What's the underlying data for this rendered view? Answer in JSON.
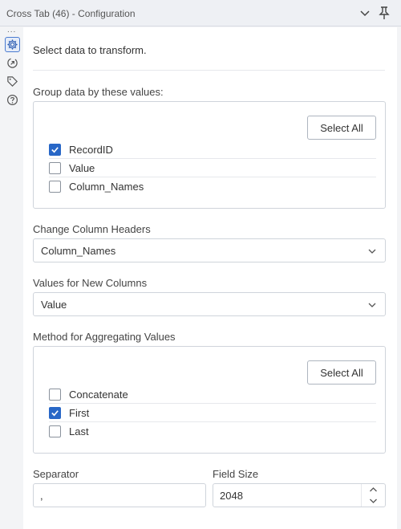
{
  "window": {
    "title": "Cross Tab (46) - Configuration"
  },
  "rail": {
    "more": "..."
  },
  "intro": "Select data to transform.",
  "group": {
    "label": "Group data by these values:",
    "select_all": "Select All",
    "items": [
      {
        "label": "RecordID",
        "checked": true
      },
      {
        "label": "Value",
        "checked": false
      },
      {
        "label": "Column_Names",
        "checked": false
      }
    ]
  },
  "headers": {
    "label": "Change Column Headers",
    "value": "Column_Names"
  },
  "values": {
    "label": "Values for New Columns",
    "value": "Value"
  },
  "aggregate": {
    "label": "Method for Aggregating Values",
    "select_all": "Select All",
    "items": [
      {
        "label": "Concatenate",
        "checked": false
      },
      {
        "label": "First",
        "checked": true
      },
      {
        "label": "Last",
        "checked": false
      }
    ]
  },
  "separator": {
    "label": "Separator",
    "value": ","
  },
  "field_size": {
    "label": "Field Size",
    "value": "2048"
  },
  "colors": {
    "accent": "#2867c7",
    "border": "#cfd4db",
    "panel": "#ffffff"
  }
}
